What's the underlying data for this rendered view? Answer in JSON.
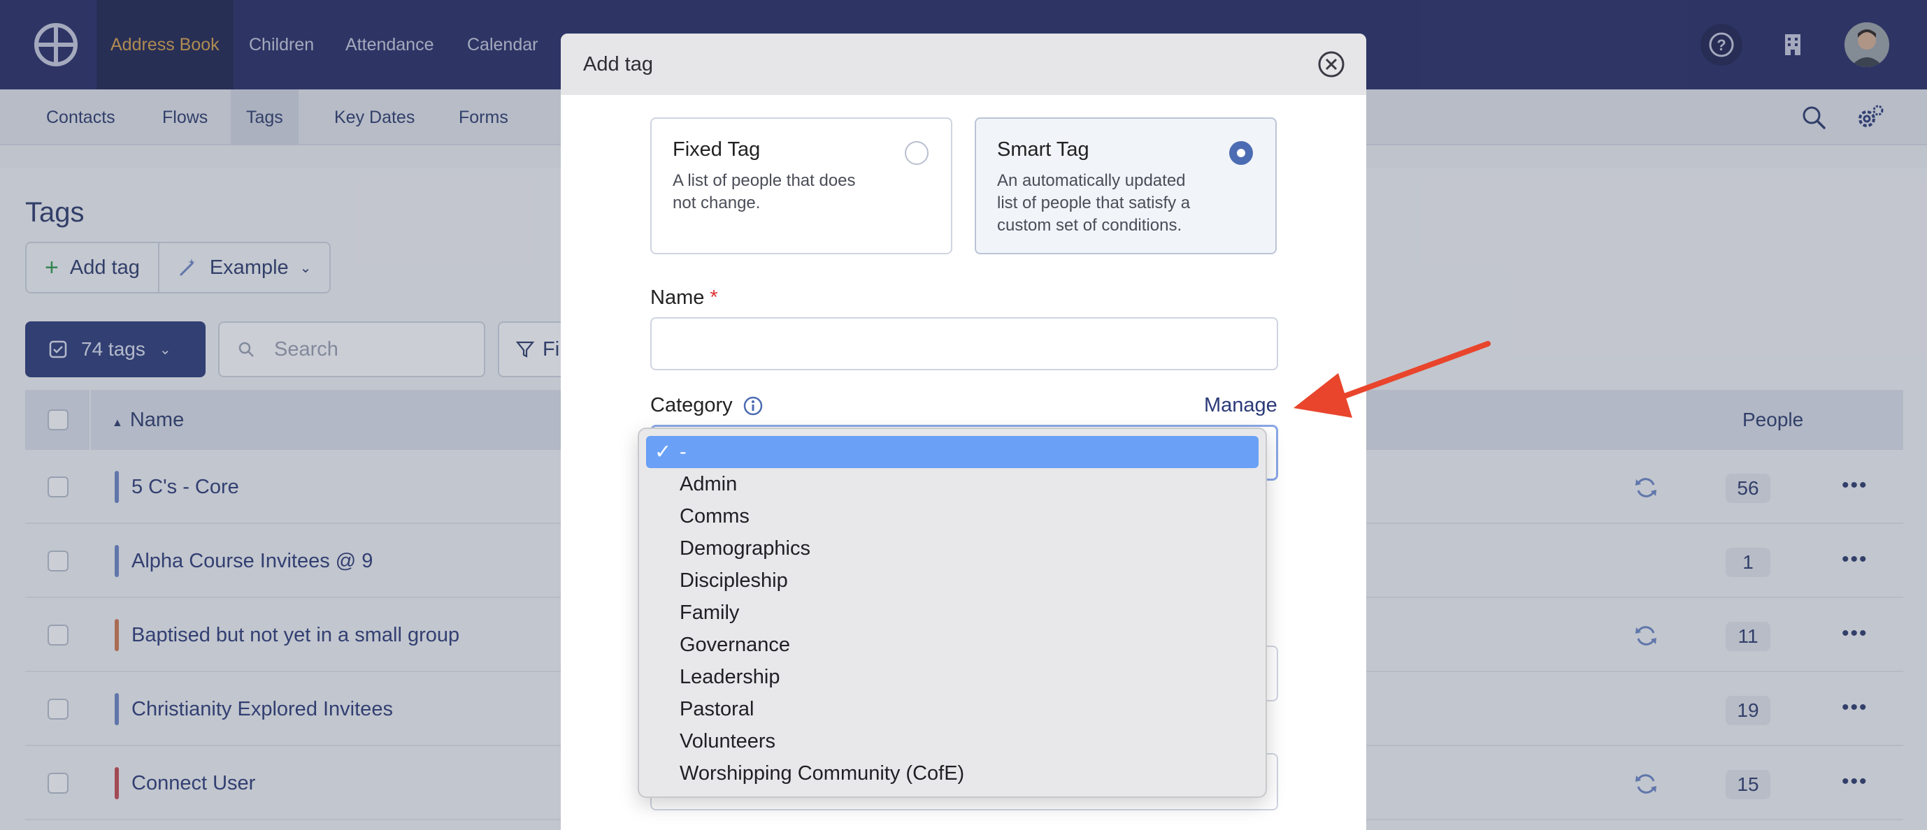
{
  "topnav": {
    "items": [
      "Address Book",
      "Children",
      "Attendance",
      "Calendar"
    ],
    "active_index": 0
  },
  "subnav": {
    "items": [
      "Contacts",
      "Flows",
      "Tags",
      "Key Dates",
      "Forms"
    ],
    "active_index": 2
  },
  "page": {
    "title": "Tags",
    "add_tag_label": "Add tag",
    "example_label": "Example",
    "tags_count_label": "74 tags",
    "search_placeholder": "Search",
    "filter_label": "Fi"
  },
  "table": {
    "name_header": "Name",
    "people_header": "People",
    "rows": [
      {
        "name": "5 C's - Core",
        "people": "56",
        "color": "#6b86c6",
        "smart": true
      },
      {
        "name": "Alpha Course Invitees @ 9",
        "people": "1",
        "color": "#6b86c6",
        "smart": false
      },
      {
        "name": "Baptised but not yet in a small group",
        "people": "11",
        "color": "#d0784e",
        "smart": true
      },
      {
        "name": "Christianity Explored Invitees",
        "people": "19",
        "color": "#6b86c6",
        "smart": false
      },
      {
        "name": "Connect User",
        "people": "15",
        "color": "#c7484e",
        "smart": true
      }
    ]
  },
  "modal": {
    "title": "Add tag",
    "fixed_tag": {
      "title": "Fixed Tag",
      "desc_line1": "A list of people that does",
      "desc_line2": "not change."
    },
    "smart_tag": {
      "title": "Smart Tag",
      "desc_line1": "An automatically updated",
      "desc_line2": "list of people that satisfy a",
      "desc_line3": "custom set of conditions."
    },
    "name_label": "Name",
    "required_mark": "*",
    "category_label": "Category",
    "manage_label": "Manage"
  },
  "category_dropdown": {
    "selected": "-",
    "check_glyph": "✓",
    "options": [
      "Admin",
      "Comms",
      "Demographics",
      "Discipleship",
      "Family",
      "Governance",
      "Leadership",
      "Pastoral",
      "Volunteers",
      "Worshipping Community (CofE)"
    ]
  },
  "colors": {
    "nav_bg": "#262c66",
    "active_nav_text": "#d9a24a",
    "primary": "#2b3a78",
    "selected_option": "#6aa0f6",
    "annotation_arrow": "#e8452c"
  }
}
